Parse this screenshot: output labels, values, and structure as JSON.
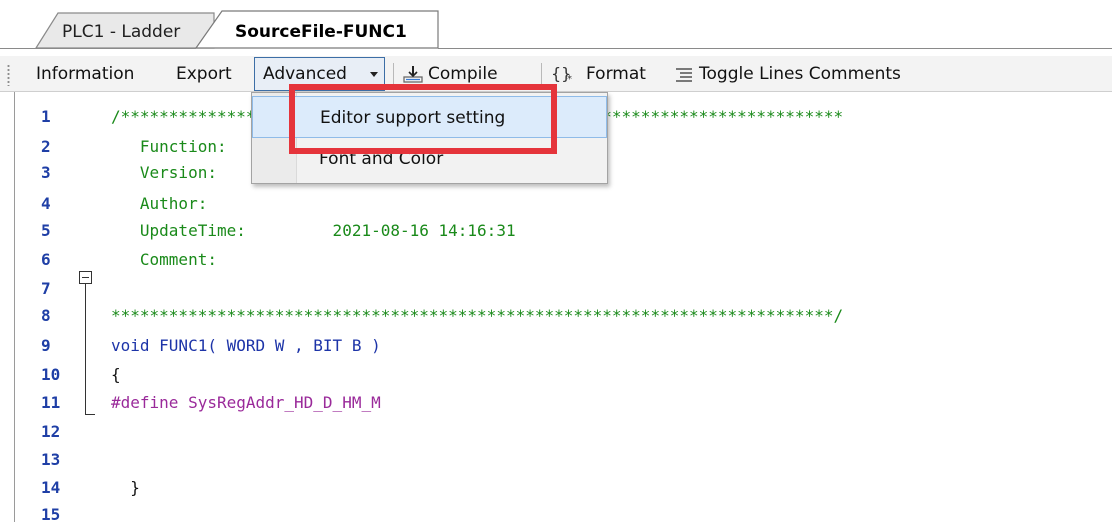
{
  "tabs": [
    {
      "label": "PLC1 - Ladder",
      "active": false
    },
    {
      "label": "SourceFile-FUNC1",
      "active": true
    }
  ],
  "toolbar": {
    "information": "Information",
    "export": "Export",
    "advanced": "Advanced",
    "compile": "Compile",
    "format": "Format",
    "toggle_comments": "Toggle Lines Comments"
  },
  "menu": {
    "items": [
      {
        "label": "Editor support setting",
        "highlighted": true
      },
      {
        "label": "Font and Color",
        "highlighted": false
      }
    ]
  },
  "editor": {
    "lines": [
      {
        "n": "1",
        "text": "/***************************************************************************"
      },
      {
        "n": "2",
        "text": "   Function:"
      },
      {
        "n": "3",
        "text": "   Version:"
      },
      {
        "n": "4",
        "text": "   Author:"
      },
      {
        "n": "5",
        "text": "   UpdateTime:         2021-08-16 14:16:31"
      },
      {
        "n": "6",
        "text": "   Comment:"
      },
      {
        "n": "7",
        "text": ""
      },
      {
        "n": "8",
        "text": "***************************************************************************/"
      },
      {
        "n": "9",
        "text": "void FUNC1( WORD W , BIT B )"
      },
      {
        "n": "10",
        "text": "{"
      },
      {
        "n": "11",
        "text": "#define SysRegAddr_HD_D_HM_M"
      },
      {
        "n": "12",
        "text": ""
      },
      {
        "n": "13",
        "text": ""
      },
      {
        "n": "14",
        "text": "  }"
      },
      {
        "n": "15",
        "text": ""
      }
    ]
  },
  "colors": {
    "comment": "#1a8a1a",
    "keyword": "#1d34a8",
    "preprocessor": "#9a2a9a",
    "line_number": "#1f3fa6",
    "callout_border": "#e5343b"
  }
}
